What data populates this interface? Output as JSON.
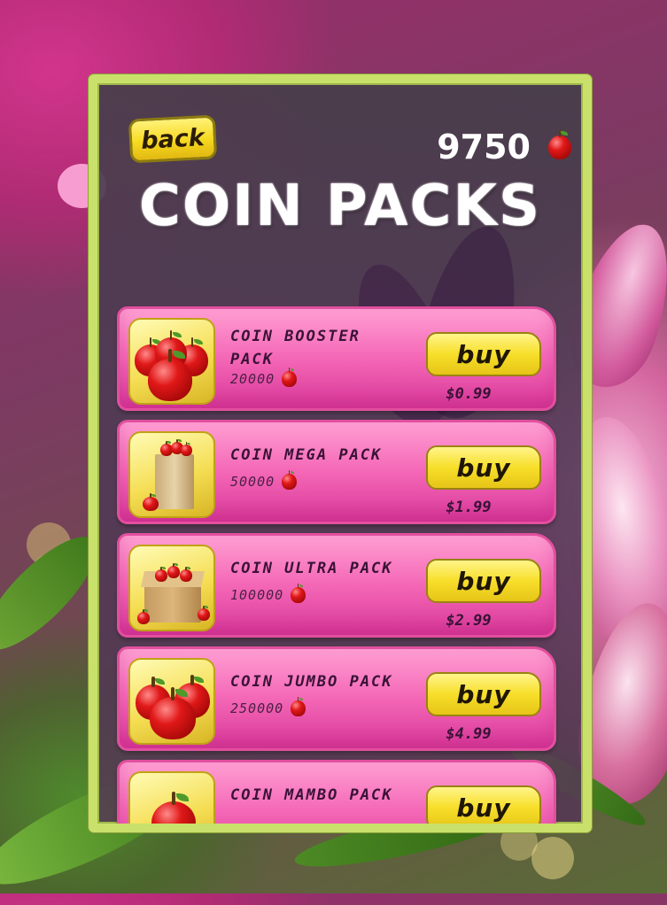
{
  "header": {
    "back_label": "back",
    "balance": "9750",
    "title": "COIN PACKS"
  },
  "packs": [
    {
      "name": "COIN BOOSTER PACK",
      "amount": "20000",
      "buy_label": "buy",
      "price": "$0.99"
    },
    {
      "name": "COIN MEGA PACK",
      "amount": "50000",
      "buy_label": "buy",
      "price": "$1.99"
    },
    {
      "name": "COIN ULTRA PACK",
      "amount": "100000",
      "buy_label": "buy",
      "price": "$2.99"
    },
    {
      "name": "COIN JUMBO PACK",
      "amount": "250000",
      "buy_label": "buy",
      "price": "$4.99"
    },
    {
      "name": "COIN MAMBO PACK",
      "amount": "",
      "buy_label": "buy",
      "price": ""
    }
  ],
  "icons": {
    "currency": "red-apple-icon",
    "pack_images": [
      "apple-pile-icon",
      "apple-bag-icon",
      "apple-box-icon",
      "apple-pile-icon",
      "apple-icon"
    ]
  },
  "colors": {
    "panel_border": "#c9e06a",
    "button_yellow": "#f6d920",
    "pack_pink": "#f467b6"
  }
}
